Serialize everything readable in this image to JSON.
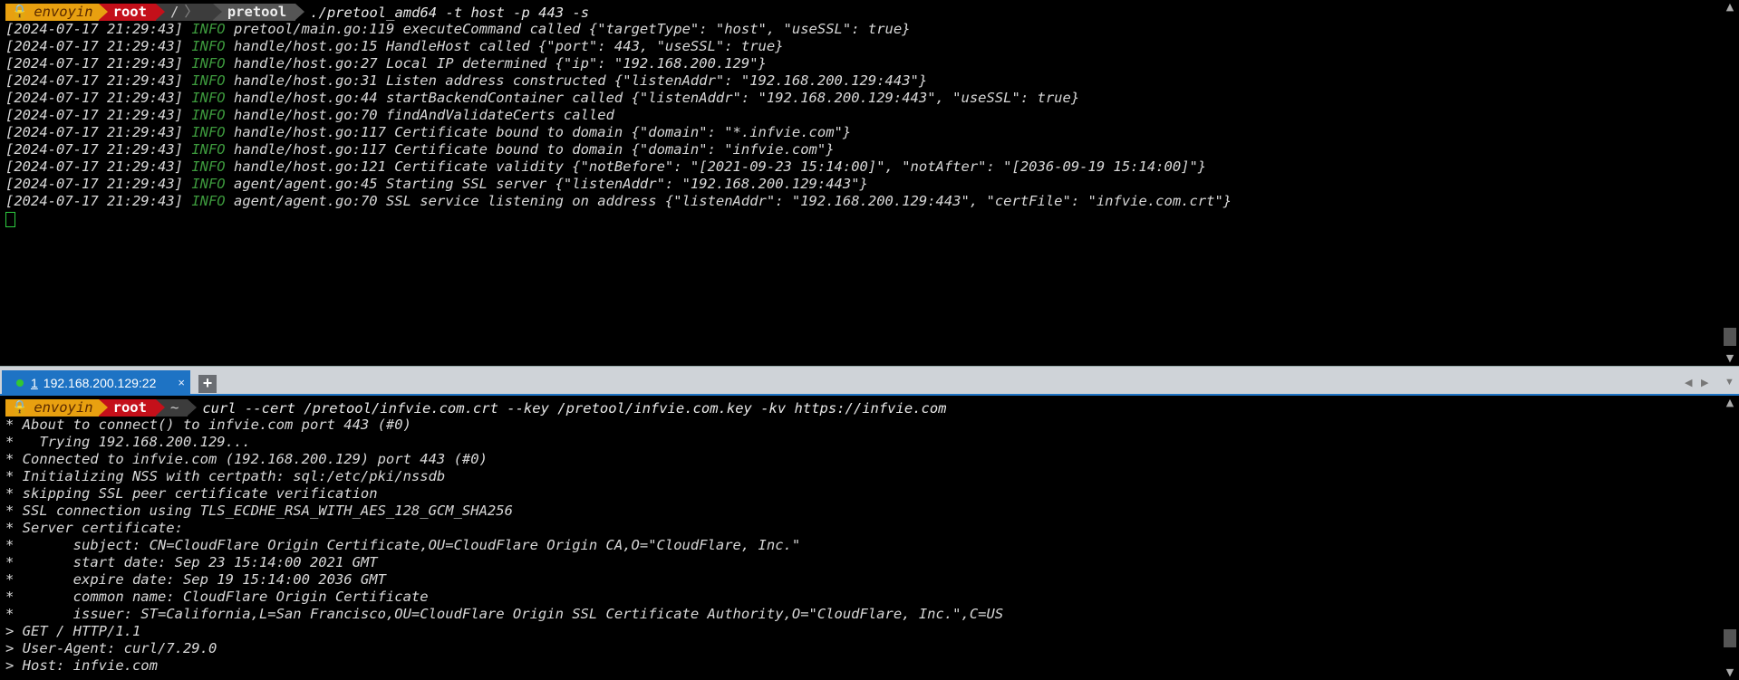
{
  "top_pane": {
    "prompt": {
      "user": "envoyin",
      "host": "root",
      "path_root": "/",
      "path_sep": "〉",
      "cwd": "pretool",
      "command": "./pretool_amd64 -t host -p 443 -s"
    },
    "log_lines": [
      {
        "ts": "[2024-07-17 21:29:43]",
        "level": "INFO",
        "msg": "pretool/main.go:119 executeCommand called {\"targetType\": \"host\", \"useSSL\": true}"
      },
      {
        "ts": "[2024-07-17 21:29:43]",
        "level": "INFO",
        "msg": "handle/host.go:15 HandleHost called {\"port\": 443, \"useSSL\": true}"
      },
      {
        "ts": "[2024-07-17 21:29:43]",
        "level": "INFO",
        "msg": "handle/host.go:27 Local IP determined {\"ip\": \"192.168.200.129\"}"
      },
      {
        "ts": "[2024-07-17 21:29:43]",
        "level": "INFO",
        "msg": "handle/host.go:31 Listen address constructed {\"listenAddr\": \"192.168.200.129:443\"}"
      },
      {
        "ts": "[2024-07-17 21:29:43]",
        "level": "INFO",
        "msg": "handle/host.go:44 startBackendContainer called {\"listenAddr\": \"192.168.200.129:443\", \"useSSL\": true}"
      },
      {
        "ts": "[2024-07-17 21:29:43]",
        "level": "INFO",
        "msg": "handle/host.go:70 findAndValidateCerts called"
      },
      {
        "ts": "[2024-07-17 21:29:43]",
        "level": "INFO",
        "msg": "handle/host.go:117 Certificate bound to domain {\"domain\": \"*.infvie.com\"}"
      },
      {
        "ts": "[2024-07-17 21:29:43]",
        "level": "INFO",
        "msg": "handle/host.go:117 Certificate bound to domain {\"domain\": \"infvie.com\"}"
      },
      {
        "ts": "[2024-07-17 21:29:43]",
        "level": "INFO",
        "msg": "handle/host.go:121 Certificate validity {\"notBefore\": \"[2021-09-23 15:14:00]\", \"notAfter\": \"[2036-09-19 15:14:00]\"}"
      },
      {
        "ts": "[2024-07-17 21:29:43]",
        "level": "INFO",
        "msg": "agent/agent.go:45 Starting SSL server {\"listenAddr\": \"192.168.200.129:443\"}"
      },
      {
        "ts": "[2024-07-17 21:29:43]",
        "level": "INFO",
        "msg": "agent/agent.go:70 SSL service listening on address {\"listenAddr\": \"192.168.200.129:443\", \"certFile\": \"infvie.com.crt\"}"
      }
    ]
  },
  "tab_bar": {
    "tab": {
      "number": "1",
      "label": "192.168.200.129:22",
      "close": "×"
    },
    "add": "+",
    "nav_left": "◀",
    "nav_right": "▶",
    "menu": "▼"
  },
  "bottom_pane": {
    "prompt": {
      "user": "envoyin",
      "host": "root",
      "cwd": "~",
      "command": "curl --cert /pretool/infvie.com.crt --key /pretool/infvie.com.key -kv https://infvie.com"
    },
    "lines": [
      "* About to connect() to infvie.com port 443 (#0)",
      "*   Trying 192.168.200.129...",
      "* Connected to infvie.com (192.168.200.129) port 443 (#0)",
      "* Initializing NSS with certpath: sql:/etc/pki/nssdb",
      "* skipping SSL peer certificate verification",
      "* SSL connection using TLS_ECDHE_RSA_WITH_AES_128_GCM_SHA256",
      "* Server certificate:",
      "*       subject: CN=CloudFlare Origin Certificate,OU=CloudFlare Origin CA,O=\"CloudFlare, Inc.\"",
      "*       start date: Sep 23 15:14:00 2021 GMT",
      "*       expire date: Sep 19 15:14:00 2036 GMT",
      "*       common name: CloudFlare Origin Certificate",
      "*       issuer: ST=California,L=San Francisco,OU=CloudFlare Origin SSL Certificate Authority,O=\"CloudFlare, Inc.\",C=US",
      "> GET / HTTP/1.1",
      "> User-Agent: curl/7.29.0",
      "> Host: infvie.com"
    ]
  },
  "colors": {
    "info_level": "#3d9a3d",
    "tab_active": "#1e73c4",
    "prompt_user_bg": "#e8a010",
    "prompt_host_bg": "#c4101a"
  }
}
